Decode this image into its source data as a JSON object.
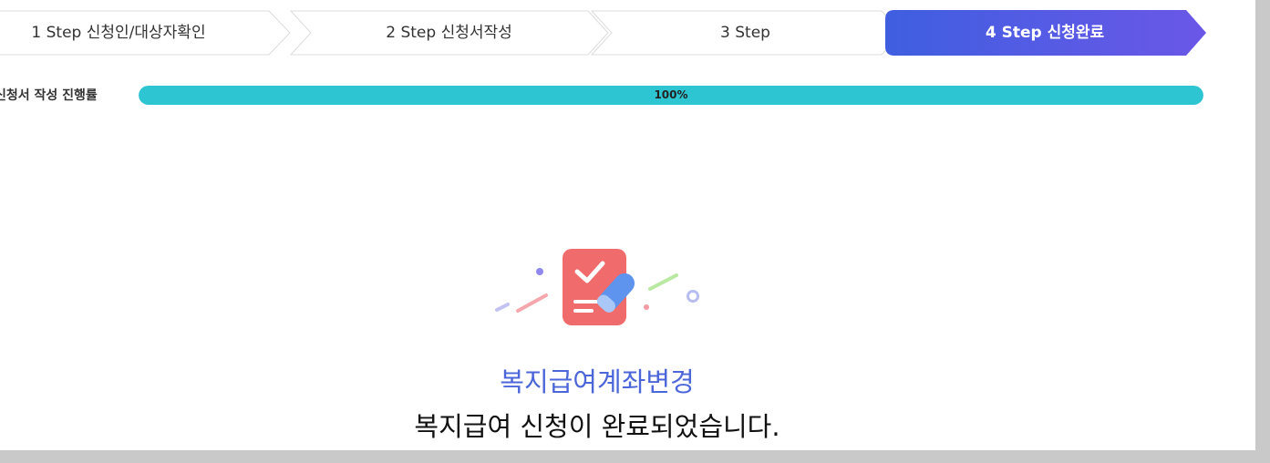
{
  "steps": [
    {
      "label": "1 Step 신청인/대상자확인",
      "active": false
    },
    {
      "label": "2 Step 신청서작성",
      "active": false
    },
    {
      "label": "3 Step",
      "active": false
    },
    {
      "label": "4 Step 신청완료",
      "active": true
    }
  ],
  "progress": {
    "label": "신청서 작성 진행률",
    "percent_text": "100%",
    "value": 100
  },
  "result": {
    "service_name": "복지급여계좌변경",
    "message": "복지급여 신청이 완료되었습니다."
  },
  "icons": {
    "illustration": "checklist-with-pencil-icon"
  },
  "colors": {
    "active_step_start": "#3f5fe0",
    "active_step_end": "#6b57e8",
    "progress_fill": "#2ec5d3",
    "service_name": "#4b66d8",
    "clipboard": "#f06b6b"
  }
}
